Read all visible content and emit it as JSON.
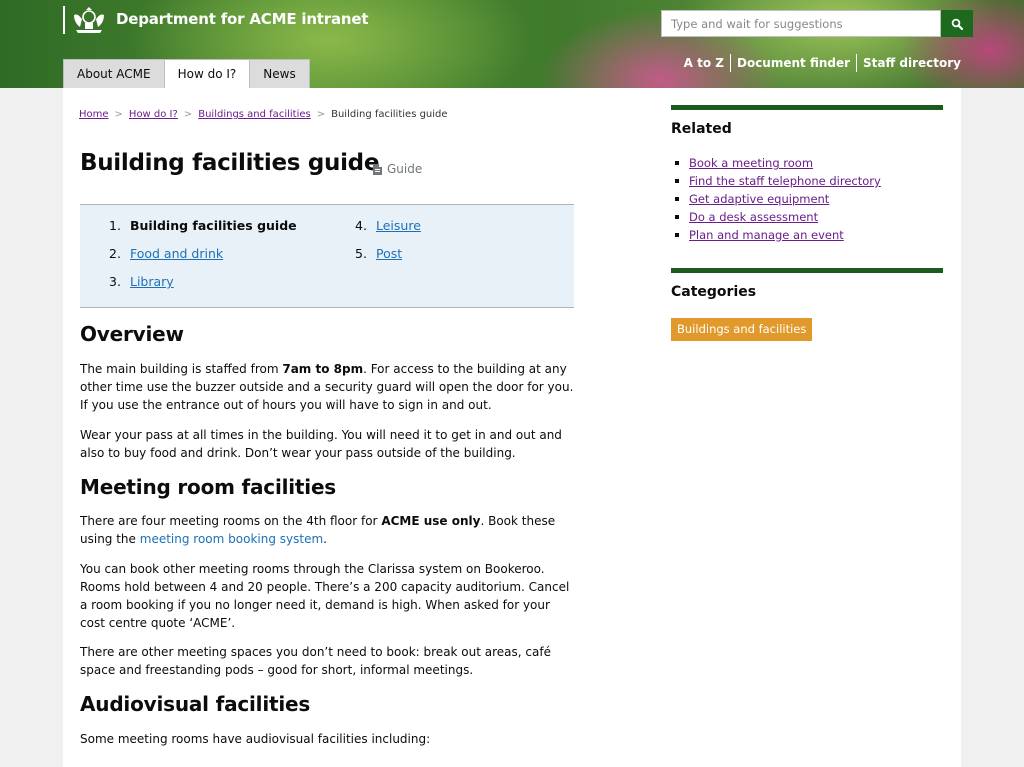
{
  "header": {
    "site_title": "Department for ACME intranet",
    "search_placeholder": "Type and wait for suggestions",
    "tabs": [
      {
        "label": "About ACME",
        "active": false
      },
      {
        "label": "How do I?",
        "active": true
      },
      {
        "label": "News",
        "active": false
      }
    ],
    "links": [
      "A to Z",
      "Document finder",
      "Staff directory"
    ]
  },
  "breadcrumb": [
    "Home",
    "How do I?",
    "Buildings and facilities",
    "Building facilities guide"
  ],
  "page": {
    "title": "Building facilities guide",
    "doc_type": "Guide"
  },
  "toc": {
    "left": [
      {
        "num": "1.",
        "label": "Building facilities guide"
      },
      {
        "num": "2.",
        "label": "Food and drink"
      },
      {
        "num": "3.",
        "label": "Library"
      }
    ],
    "right": [
      {
        "num": "4.",
        "label": "Leisure"
      },
      {
        "num": "5.",
        "label": "Post"
      }
    ]
  },
  "content": {
    "overview_heading": "Overview",
    "overview_p1_a": "The main building is staffed from ",
    "overview_p1_bold": "7am to 8pm",
    "overview_p1_b": ". For access to the building at any other time use the buzzer outside and a security guard will open the door for you. If you use the entrance out of hours you will have to sign in and out.",
    "overview_p2": "Wear your pass at all times in the building. You will need it to get in and out and also to buy food and drink. Don’t wear your pass outside of the building.",
    "meeting_heading": "Meeting room facilities",
    "meeting_p1_a": "There are four meeting rooms on the 4th floor for ",
    "meeting_p1_bold": "ACME use only",
    "meeting_p1_b": ". Book these using the ",
    "meeting_p1_link": "meeting room booking system",
    "meeting_p1_c": ".",
    "meeting_p2": "You can book other meeting rooms through the Clarissa system on  Bookeroo. Rooms hold between 4 and 20 people. There’s a 200 capacity auditorium. Cancel a room booking if you no longer need it, demand is high. When asked for your cost centre quote ‘ACME’.",
    "meeting_p3": "There are other meeting spaces you don’t need to book: break out areas, café space and freestanding pods – good for short, informal meetings.",
    "av_heading": "Audiovisual facilities",
    "av_p1": "Some meeting rooms have audiovisual facilities including:"
  },
  "sidebar": {
    "related_heading": "Related",
    "related": [
      "Book a meeting room",
      "Find the staff telephone directory",
      "Get adaptive equipment",
      "Do a desk assessment",
      "Plan and manage an event"
    ],
    "categories_heading": "Categories",
    "category": "Buildings and facilities"
  },
  "colors": {
    "header_green": "#3f7a2c",
    "search_button": "#1d6a1e",
    "sidebar_rule": "#1d5a1d",
    "category_tag": "#e0992a",
    "link_blue": "#1d70b8",
    "visited_purple": "#6b1d8c"
  },
  "icons": {
    "crest": "crest-icon",
    "search": "search-icon",
    "document": "document-icon"
  }
}
